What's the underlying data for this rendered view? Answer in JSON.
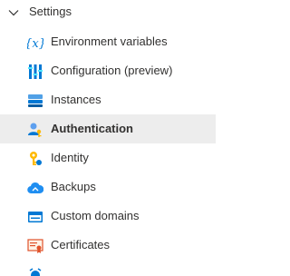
{
  "settings_group": {
    "label": "Settings",
    "expanded": true,
    "items": [
      {
        "label": "Environment variables",
        "icon": "variables-icon"
      },
      {
        "label": "Configuration (preview)",
        "icon": "configuration-icon"
      },
      {
        "label": "Instances",
        "icon": "instances-icon"
      },
      {
        "label": "Authentication",
        "icon": "authentication-icon",
        "selected": true
      },
      {
        "label": "Identity",
        "icon": "identity-icon"
      },
      {
        "label": "Backups",
        "icon": "backups-icon"
      },
      {
        "label": "Custom domains",
        "icon": "custom-domains-icon"
      },
      {
        "label": "Certificates",
        "icon": "certificates-icon"
      }
    ]
  },
  "colors": {
    "selected_background": "#ededed",
    "text": "#323130",
    "accent_blue": "#0078d4"
  }
}
